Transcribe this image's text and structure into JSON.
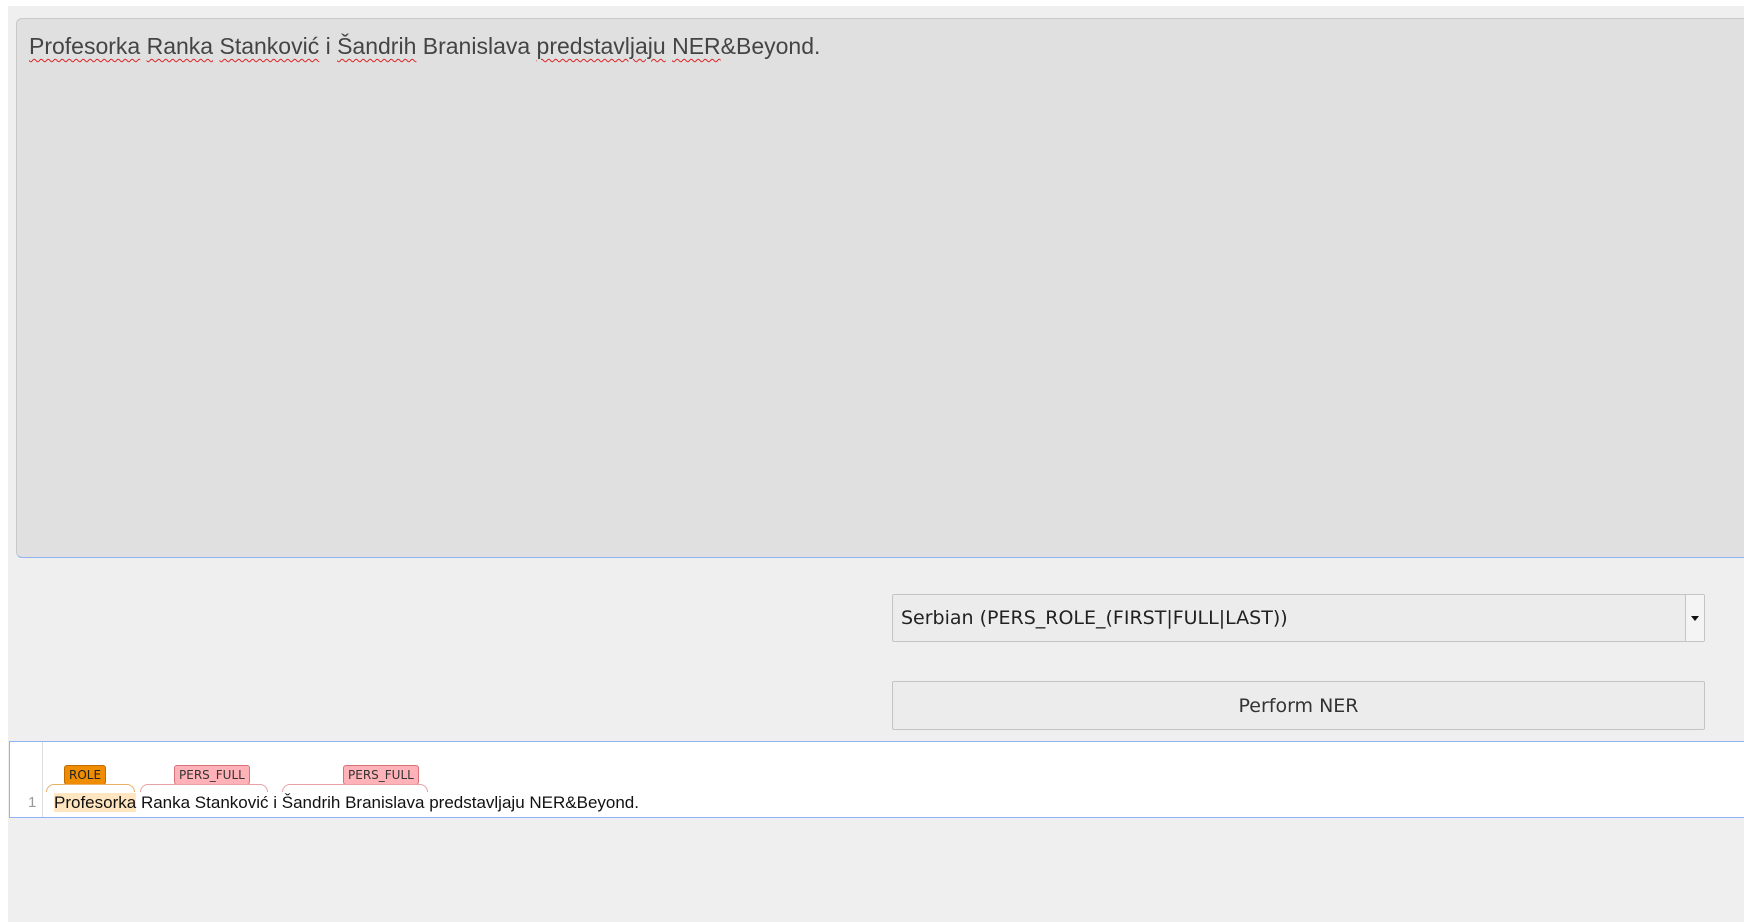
{
  "input": {
    "tokens": [
      {
        "text": "Profesorka",
        "spell": true
      },
      {
        "text": " ",
        "spell": false
      },
      {
        "text": "Ranka",
        "spell": true
      },
      {
        "text": " ",
        "spell": false
      },
      {
        "text": "Stanković",
        "spell": true
      },
      {
        "text": " i ",
        "spell": false
      },
      {
        "text": "Šandrih",
        "spell": true
      },
      {
        "text": " Branislava ",
        "spell": false
      },
      {
        "text": "predstavljaju",
        "spell": true
      },
      {
        "text": " ",
        "spell": false
      },
      {
        "text": "NER",
        "spell": true
      },
      {
        "text": "&Beyond.",
        "spell": false
      }
    ]
  },
  "model_select": {
    "selected": "Serbian (PERS_ROLE_(FIRST|FULL|LAST))"
  },
  "perform_button": {
    "label": "Perform NER"
  },
  "result": {
    "line_number": "1",
    "words": {
      "w0": "Profesorka",
      "w1": "Ranka Stanković",
      "w2": "i",
      "w3": "Šandrih Branislava",
      "w4": "predstavljaju NER&Beyond."
    },
    "entities": [
      {
        "label": "ROLE",
        "text": "Profesorka",
        "color": "#f08c00"
      },
      {
        "label": "PERS_FULL",
        "text": "Ranka Stanković",
        "color": "#ffb2b8"
      },
      {
        "label": "PERS_FULL",
        "text": "Šandrih Branislava",
        "color": "#ffb2b8"
      }
    ]
  }
}
